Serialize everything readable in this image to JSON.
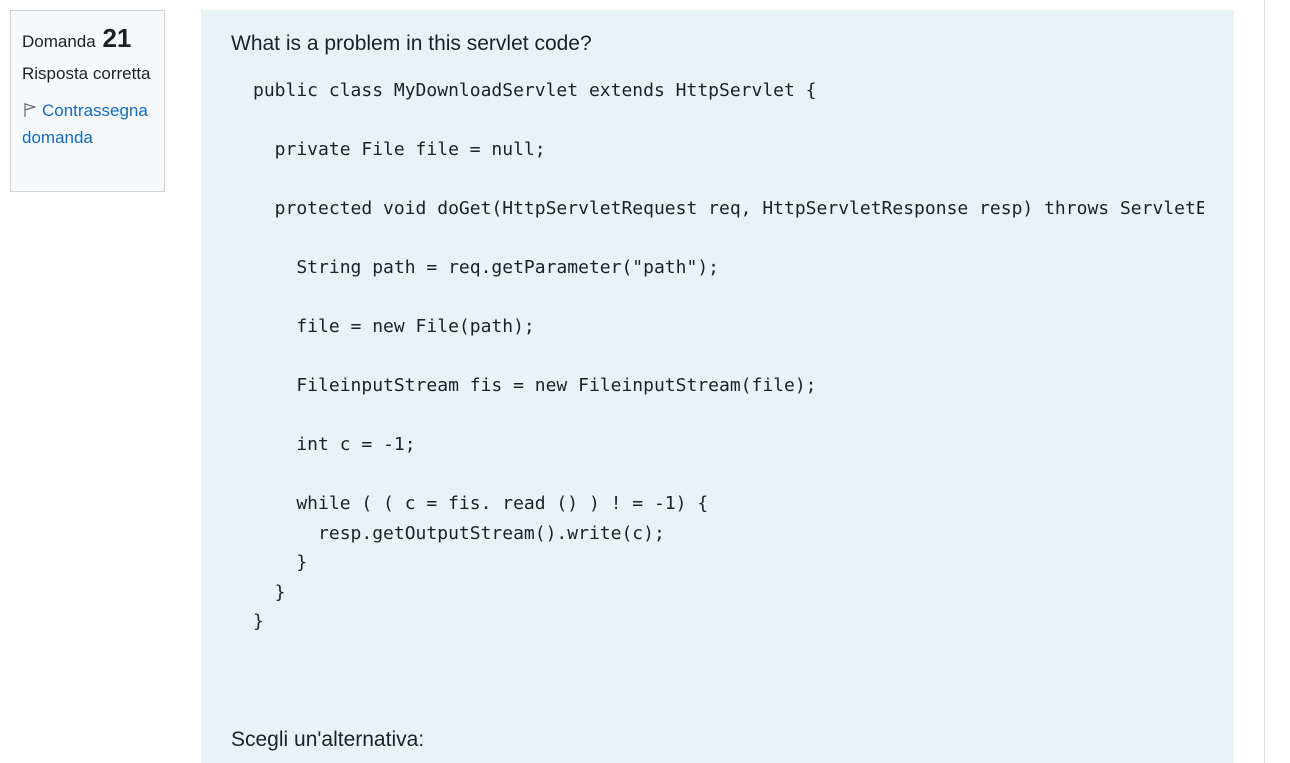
{
  "info": {
    "question_label": "Domanda",
    "question_number": "21",
    "state": "Risposta corretta",
    "flag_label": "Contrassegna domanda"
  },
  "question": {
    "text": "What is a problem in this servlet code?",
    "code": "public class MyDownloadServlet extends HttpServlet {\n\n  private File file = null;\n\n  protected void doGet(HttpServletRequest req, HttpServletResponse resp) throws ServletE\n\n    String path = req.getParameter(\"path\");\n\n    file = new File(path);\n\n    FileinputStream fis = new FileinputStream(file);\n\n    int c = -1;\n\n    while ( ( c = fis. read () ) ! = -1) {\n      resp.getOutputStream().write(c);\n    }\n  }\n}",
    "prompt": "Scegli un'alternativa:"
  },
  "scrollbar": {
    "left_arrow": "‹",
    "right_arrow": "›"
  },
  "icons": {
    "flag": "flag-icon"
  },
  "colors": {
    "link": "#0f6cbf",
    "content_bg": "#e7f3f5",
    "info_bg": "#f8f9fa"
  }
}
